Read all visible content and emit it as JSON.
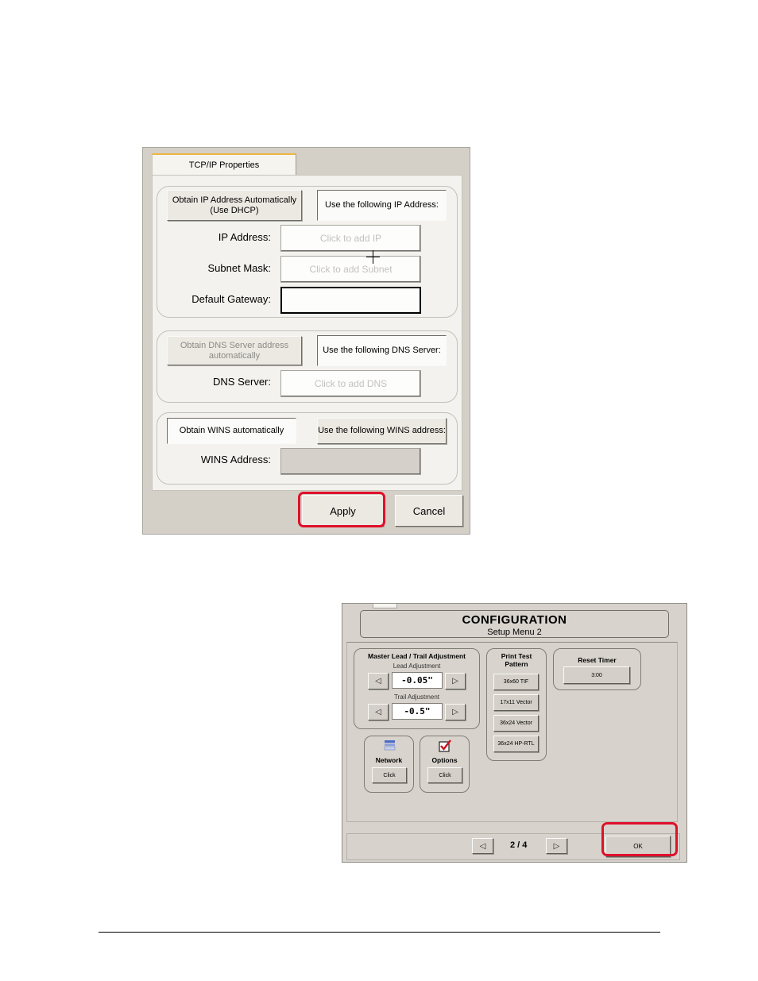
{
  "tcpip": {
    "tab_label": "TCP/IP Properties",
    "ip_group": {
      "auto_button": "Obtain IP Address Automatically\n(Use DHCP)",
      "manual_button": "Use the following IP Address:",
      "ip_label": "IP Address:",
      "ip_placeholder": "Click to add IP",
      "subnet_label": "Subnet Mask:",
      "subnet_placeholder": "Click to add Subnet",
      "gateway_label": "Default Gateway:",
      "gateway_value": ""
    },
    "dns_group": {
      "auto_button": "Obtain DNS Server address\nautomatically",
      "manual_button": "Use the following DNS Server:",
      "dns_label": "DNS Server:",
      "dns_placeholder": "Click to add DNS"
    },
    "wins_group": {
      "auto_button": "Obtain WINS automatically",
      "manual_button": "Use the following WINS address:",
      "wins_label": "WINS Address:",
      "wins_value": ""
    },
    "apply_label": "Apply",
    "cancel_label": "Cancel",
    "highlight_color": "#e0102a"
  },
  "config": {
    "title": "CONFIGURATION",
    "subtitle": "Setup Menu 2",
    "master": {
      "title": "Master Lead / Trail Adjustment",
      "lead_label": "Lead Adjustment",
      "lead_value": "-0.05\"",
      "trail_label": "Trail Adjustment",
      "trail_value": "-0.5\""
    },
    "network": {
      "title": "Network",
      "button": "Click"
    },
    "options": {
      "title": "Options",
      "button": "Click"
    },
    "print_test": {
      "title": "Print Test\nPattern",
      "buttons": [
        "36x60 TIF",
        "17x11 Vector",
        "36x24 Vector",
        "36x24 HP-RTL"
      ]
    },
    "reset_timer": {
      "title": "Reset Timer",
      "value": "3:00"
    },
    "page_indicator": "2 / 4",
    "ok_label": "OK"
  }
}
